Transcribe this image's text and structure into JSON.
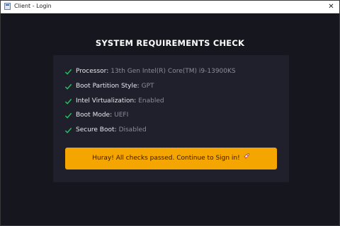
{
  "window": {
    "title": "Client - Login",
    "close_glyph": "✕"
  },
  "heading": "SYSTEM REQUIREMENTS CHECK",
  "checks": [
    {
      "label": "Processor:",
      "value": "13th Gen Intel(R) Core(TM) i9-13900KS"
    },
    {
      "label": "Boot Partition Style:",
      "value": "GPT"
    },
    {
      "label": "Intel Virtualization:",
      "value": "Enabled"
    },
    {
      "label": "Boot Mode:",
      "value": "UEFI"
    },
    {
      "label": "Secure Boot:",
      "value": "Disabled"
    }
  ],
  "cta": {
    "label": "Huray! All checks passed. Continue to Sign in!",
    "icon": "rocket-icon"
  },
  "colors": {
    "accent": "#f5a500",
    "check": "#22c55e",
    "background": "#16161e",
    "panel": "#20202c"
  }
}
